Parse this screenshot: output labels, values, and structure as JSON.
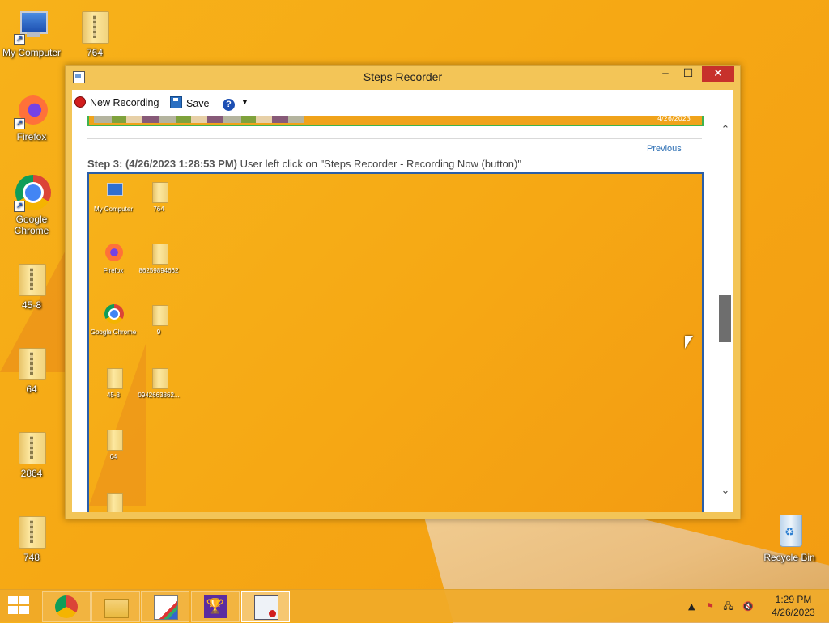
{
  "desktop": {
    "icons": [
      {
        "label": "My Computer"
      },
      {
        "label": "764"
      },
      {
        "label": "Firefox"
      },
      {
        "label": "Google Chrome"
      },
      {
        "label": "45-8"
      },
      {
        "label": "64"
      },
      {
        "label": "2864"
      },
      {
        "label": "748"
      },
      {
        "label": "Recycle Bin"
      }
    ]
  },
  "window": {
    "title": "Steps Recorder",
    "controls": {
      "minimize": "‒",
      "maximize": "☐",
      "close": "✕"
    },
    "toolbar": {
      "new_recording": "New Recording",
      "save": "Save",
      "help": "?",
      "dropdown": "▼"
    },
    "preview_date": "4/26/2023",
    "previous_link": "Previous",
    "step": {
      "heading": "Step 3: (4/26/2023 1:28:53 PM)",
      "description": " User left click on \"Steps Recorder - Recording Now (button)\""
    },
    "screenshot_icons": [
      {
        "label": "My Computer"
      },
      {
        "label": "764"
      },
      {
        "label": "Firefox"
      },
      {
        "label": "86259894662"
      },
      {
        "label": "Google Chrome"
      },
      {
        "label": "9"
      },
      {
        "label": "45-8"
      },
      {
        "label": "0942663862..."
      },
      {
        "label": "64"
      }
    ],
    "scroll": {
      "up": "⌃",
      "down": "⌄"
    }
  },
  "taskbar": {
    "apps": [
      "Google Chrome",
      "File Explorer",
      "Paint",
      "Trophy app",
      "Steps Recorder"
    ],
    "clock": {
      "time": "1:29 PM",
      "date": "4/26/2023"
    }
  },
  "colors": {
    "accent": "#c7312b",
    "desktop": "#f6a814",
    "link": "#2a6db3"
  }
}
